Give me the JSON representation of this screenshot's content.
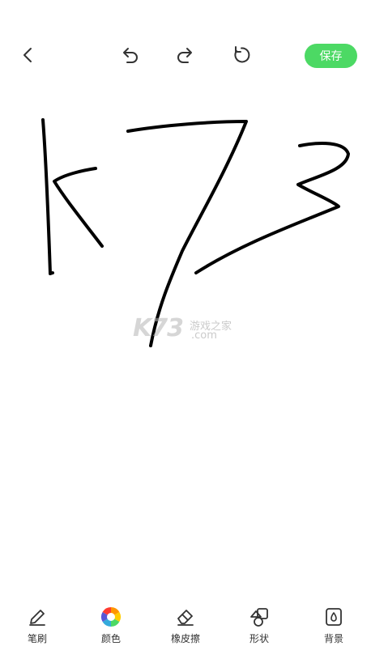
{
  "toolbar": {
    "save_label": "保存"
  },
  "tools": [
    {
      "label": "笔刷",
      "icon": "pencil-icon"
    },
    {
      "label": "颜色",
      "icon": "color-wheel-icon"
    },
    {
      "label": "橡皮擦",
      "icon": "eraser-icon"
    },
    {
      "label": "形状",
      "icon": "shapes-icon"
    },
    {
      "label": "背景",
      "icon": "background-drop-icon"
    }
  ],
  "watermark": {
    "logo": "K73",
    "name": "游戏之家",
    "domain": ".com"
  },
  "colors": {
    "accent": "#4cd964",
    "stroke": "#000000"
  }
}
